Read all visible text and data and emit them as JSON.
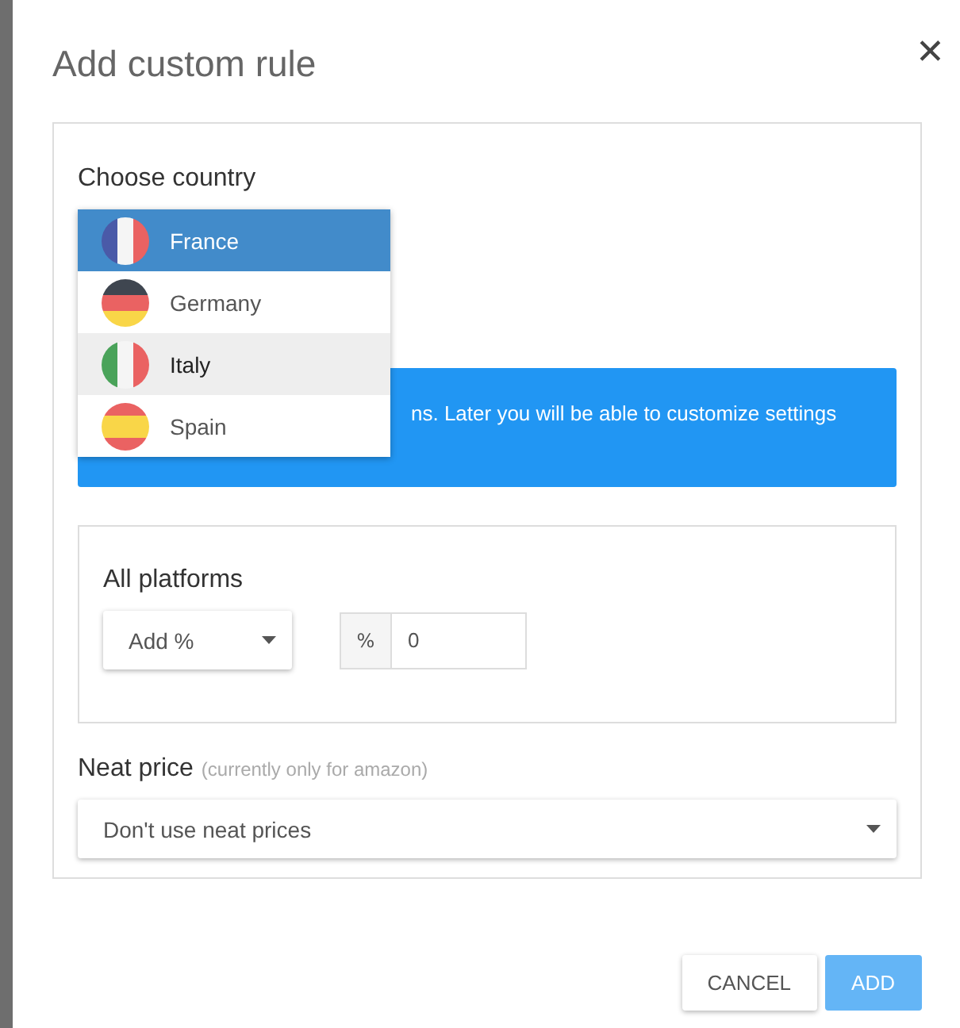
{
  "dialog": {
    "title": "Add custom rule",
    "close": "✕"
  },
  "country": {
    "label": "Choose country",
    "options": [
      {
        "name": "France",
        "kind": "france",
        "selected": true,
        "hovered": false
      },
      {
        "name": "Germany",
        "kind": "germany",
        "selected": false,
        "hovered": false
      },
      {
        "name": "Italy",
        "kind": "italy",
        "selected": false,
        "hovered": true
      },
      {
        "name": "Spain",
        "kind": "spain",
        "selected": false,
        "hovered": false
      }
    ]
  },
  "info": {
    "text": "ns. Later you will be able to customize settings"
  },
  "platforms": {
    "title": "All platforms",
    "mode": "Add %",
    "addon": "%",
    "value": "0"
  },
  "neat_price": {
    "label": "Neat price",
    "hint": "(currently only for amazon)",
    "value": "Don't use neat prices"
  },
  "buttons": [
    {
      "label": "CANCEL",
      "kind": "secondary"
    },
    {
      "label": "ADD",
      "kind": "primary"
    }
  ]
}
